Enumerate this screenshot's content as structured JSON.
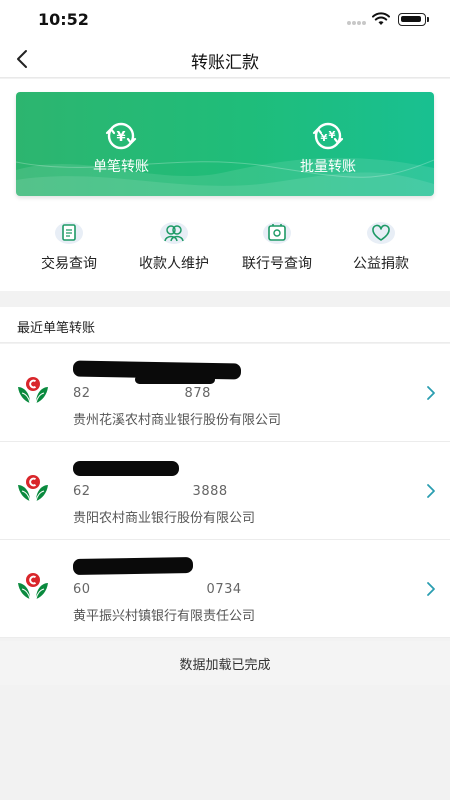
{
  "status_bar": {
    "time": "10:52"
  },
  "nav": {
    "title": "转账汇款",
    "back_icon": "chevron-left-icon"
  },
  "banner": {
    "single_transfer": {
      "label": "单笔转账",
      "icon": "yuan-exchange-icon"
    },
    "batch_transfer": {
      "label": "批量转账",
      "icon": "yuan-batch-exchange-icon"
    }
  },
  "quick_actions": [
    {
      "label": "交易查询",
      "icon": "document-icon"
    },
    {
      "label": "收款人维护",
      "icon": "contacts-icon"
    },
    {
      "label": "联行号查询",
      "icon": "bank-number-search-icon"
    },
    {
      "label": "公益捐款",
      "icon": "heart-icon"
    }
  ],
  "recent": {
    "title": "最近单笔转账",
    "payees": [
      {
        "name": "",
        "account_start": "82",
        "account_end": "878",
        "bank": "贵州花溪农村商业银行股份有限公司"
      },
      {
        "name": "",
        "account_start": "62",
        "account_end": "3888",
        "bank": "贵阳农村商业银行股份有限公司"
      },
      {
        "name": "",
        "account_start": "60",
        "account_end": "0734",
        "bank": "黄平振兴村镇银行有限责任公司"
      }
    ]
  },
  "footer": {
    "load_status": "数据加载已完成"
  },
  "colors": {
    "banner_start": "#2db56f",
    "banner_end": "#19c091",
    "accent": "#1aa86a",
    "chevron": "#2a9db0",
    "logo_red": "#d9262b",
    "logo_green": "#0a8a3e"
  }
}
